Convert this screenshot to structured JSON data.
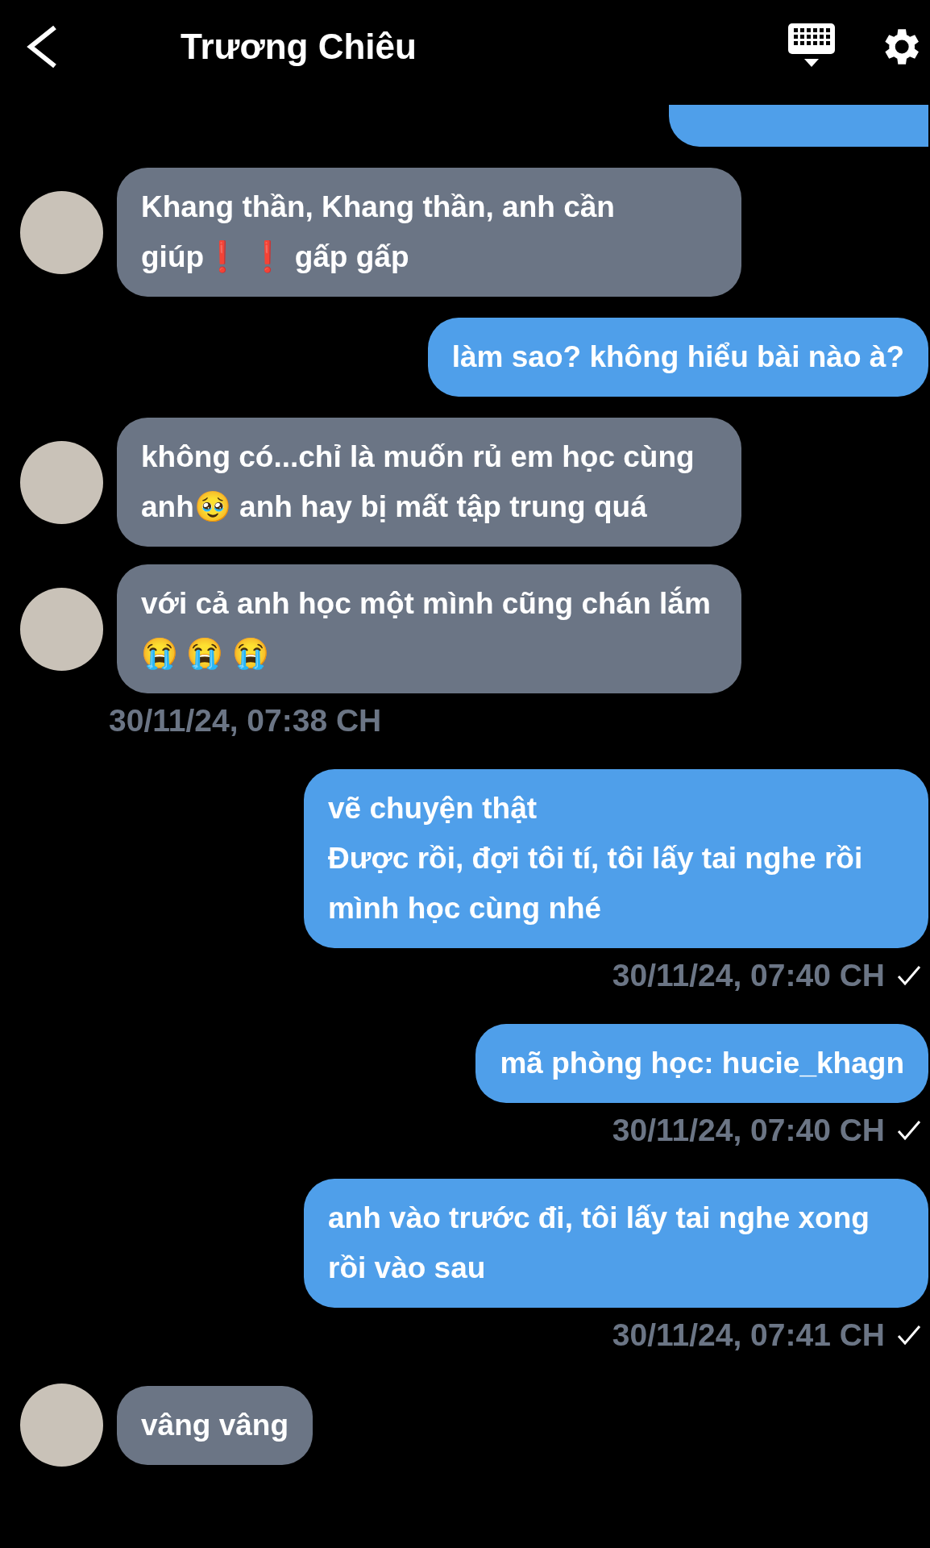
{
  "header": {
    "title": "Trương Chiêu"
  },
  "messages": [
    {
      "kind": "outgoing",
      "cut_off": true
    },
    {
      "kind": "incoming",
      "avatar": true,
      "text": "Khang thần, Khang thần, anh cần giúp❗ ❗ gấp gấp"
    },
    {
      "kind": "outgoing",
      "text": "làm sao? không hiểu bài nào à?"
    },
    {
      "kind": "incoming",
      "avatar": true,
      "text": "không có...chỉ là muốn rủ em học cùng anh🥹 anh hay bị mất tập trung quá"
    },
    {
      "kind": "incoming",
      "avatar": true,
      "text": "với cả anh học một mình cũng chán lắm😭 😭 😭",
      "timestamp": "30/11/24, 07:38 CH"
    },
    {
      "kind": "outgoing",
      "text": "vẽ chuyện thật\nĐược rồi, đợi tôi tí, tôi lấy tai nghe rồi mình học cùng nhé",
      "timestamp": "30/11/24, 07:40 CH",
      "read": true
    },
    {
      "kind": "outgoing",
      "text": "mã phòng học: hucie_khagn",
      "timestamp": "30/11/24, 07:40 CH",
      "read": true
    },
    {
      "kind": "outgoing",
      "text": "anh vào trước đi, tôi lấy tai nghe xong rồi vào sau",
      "timestamp": "30/11/24, 07:41 CH",
      "read": true
    },
    {
      "kind": "incoming",
      "avatar": true,
      "text": "vâng vâng"
    }
  ]
}
